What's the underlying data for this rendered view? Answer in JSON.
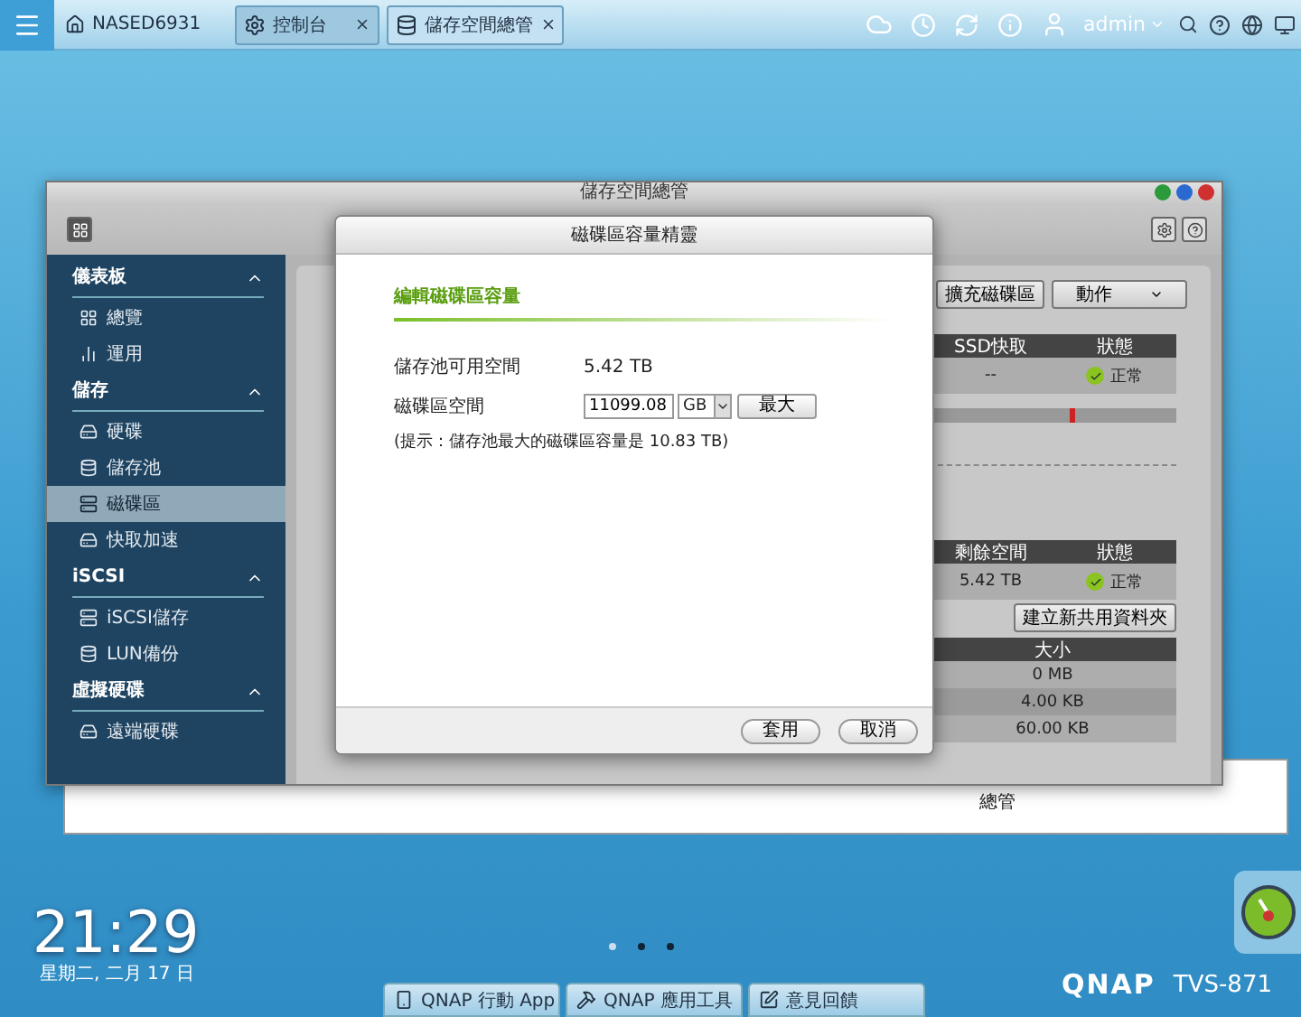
{
  "top_bar": {
    "host": "NASED6931",
    "tabs": [
      {
        "label": "控制台",
        "selected": false
      },
      {
        "label": "儲存空間總管",
        "selected": true
      }
    ],
    "user": "admin"
  },
  "back_window": {
    "text": "總管"
  },
  "window": {
    "title": "儲存空間總管",
    "sidebar": [
      {
        "title": "儀表板",
        "expanded": true,
        "children": [
          {
            "label": "總覽",
            "selected": false
          },
          {
            "label": "運用",
            "selected": false
          }
        ]
      },
      {
        "title": "儲存",
        "expanded": true,
        "children": [
          {
            "label": "硬碟",
            "selected": false
          },
          {
            "label": "儲存池",
            "selected": false
          },
          {
            "label": "磁碟區",
            "selected": true
          },
          {
            "label": "快取加速",
            "selected": false
          }
        ]
      },
      {
        "title": "iSCSI",
        "expanded": true,
        "children": [
          {
            "label": "iSCSI儲存",
            "selected": false
          },
          {
            "label": "LUN備份",
            "selected": false
          }
        ]
      },
      {
        "title": "虛擬硬碟",
        "expanded": true,
        "children": [
          {
            "label": "遠端硬碟",
            "selected": false
          }
        ]
      }
    ],
    "content": {
      "buttons": [
        "擴充磁碟區",
        "動作"
      ],
      "table1": {
        "columns": [
          "SSD快取",
          "狀態"
        ],
        "row": [
          "--",
          "正常"
        ]
      },
      "table2": {
        "columns": [
          "剩餘空間",
          "狀態"
        ],
        "row": [
          "5.42 TB",
          "正常"
        ]
      },
      "create_button": "建立新共用資料夾",
      "table3": {
        "columns": [
          "大小"
        ],
        "rows": [
          "0 MB",
          "4.00 KB",
          "60.00 KB"
        ]
      }
    }
  },
  "dialog": {
    "title": "磁碟區容量精靈",
    "heading": "編輯磁碟區容量",
    "available_label": "儲存池可用空間",
    "available_value": "5.42 TB",
    "size_label": "磁碟區空間",
    "size_value": "11099.08",
    "unit": "GB",
    "max_button": "最大",
    "hint": "(提示：儲存池最大的磁碟區容量是 10.83 TB)",
    "buttons": [
      "套用",
      "取消"
    ]
  },
  "desktop": {
    "time": "21:29",
    "date": "星期二, 二月 17 日",
    "pages": [
      {
        "selected": true
      },
      {
        "selected": false
      },
      {
        "selected": false
      }
    ],
    "dock": [
      "QNAP 行動 App",
      "QNAP 應用工具",
      "意見回饋"
    ],
    "brand": "QNAP",
    "model": "TVS-871"
  }
}
